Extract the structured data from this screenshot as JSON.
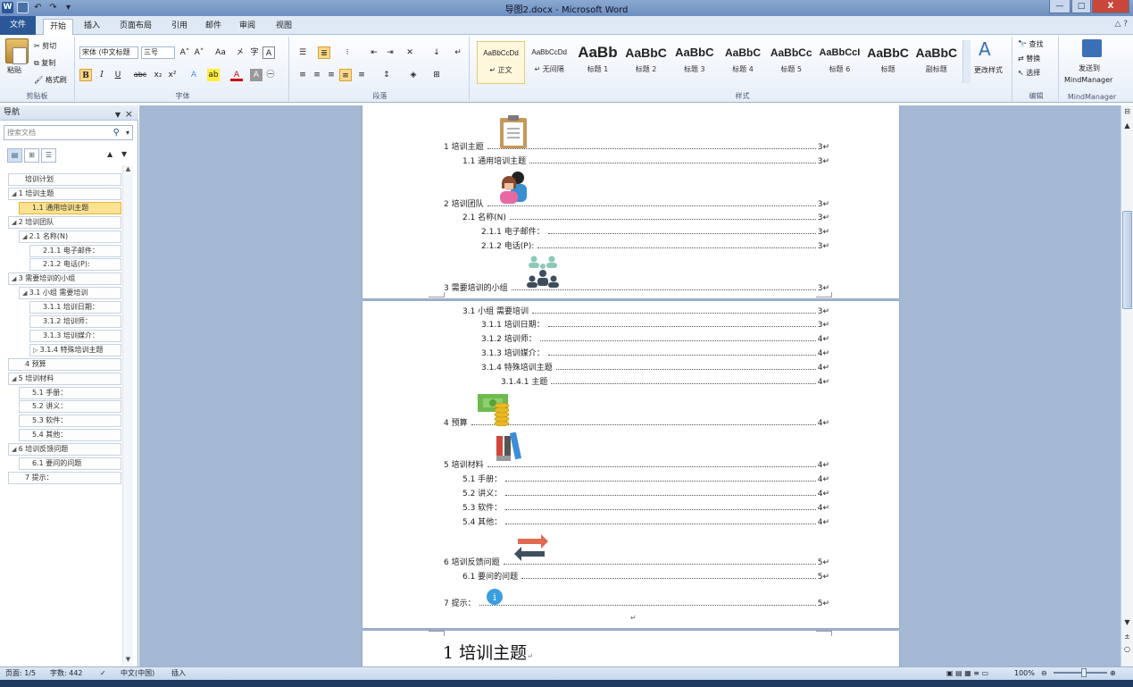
{
  "window": {
    "title": "导图2.docx - Microsoft Word",
    "close_label": "X",
    "min_label": "—",
    "max_label": "□"
  },
  "tabs": {
    "file": "文件",
    "items": [
      "开始",
      "插入",
      "页面布局",
      "引用",
      "邮件",
      "审阅",
      "视图"
    ]
  },
  "ribbon": {
    "clipboard": {
      "paste": "粘贴",
      "cut": "剪切",
      "copy": "复制",
      "format_painter": "格式刷",
      "label": "剪贴板"
    },
    "font": {
      "name": "宋体 (中文标题",
      "size": "三号",
      "label": "字体",
      "grow": "A˄",
      "shrink": "A˅",
      "case": "Aa",
      "clear": "A",
      "bold": "B",
      "italic": "I",
      "underline": "U",
      "strike": "abc",
      "sub": "x₂",
      "sup": "x²"
    },
    "paragraph": {
      "label": "段落"
    },
    "styles": {
      "label": "样式",
      "change_styles": "更改样式",
      "items": [
        {
          "sample": "AaBbCcDd",
          "name": "↵ 正文"
        },
        {
          "sample": "AaBbCcDd",
          "name": "↵ 无间隔"
        },
        {
          "sample": "AaBb",
          "name": "标题 1"
        },
        {
          "sample": "AaBbC",
          "name": "标题 2"
        },
        {
          "sample": "AaBbC",
          "name": "标题 3"
        },
        {
          "sample": "AaBbC",
          "name": "标题 4"
        },
        {
          "sample": "AaBbCc",
          "name": "标题 5"
        },
        {
          "sample": "AaBbCcI",
          "name": "标题 6"
        },
        {
          "sample": "AaBbC",
          "name": "标题"
        },
        {
          "sample": "AaBbC",
          "name": "副标题"
        }
      ]
    },
    "editing": {
      "find": "查找",
      "replace": "替换",
      "select": "选择",
      "label": "编辑"
    },
    "mindmanager": {
      "send": "发送到",
      "app": "MindManager",
      "label": "MindManager"
    }
  },
  "nav": {
    "title": "导航",
    "search_placeholder": "搜索文档",
    "items": [
      {
        "text": "培训计划",
        "lv": 0,
        "arrow": ""
      },
      {
        "text": "1 培训主题",
        "lv": 0,
        "arrow": "◢"
      },
      {
        "text": "1.1 通用培训主题",
        "lv": 1,
        "arrow": "",
        "selected": true
      },
      {
        "text": "2 培训团队",
        "lv": 0,
        "arrow": "◢"
      },
      {
        "text": "2.1 名称(N)",
        "lv": 1,
        "arrow": "◢"
      },
      {
        "text": "2.1.1 电子邮件：",
        "lv": 2,
        "arrow": ""
      },
      {
        "text": "2.1.2 电话(P):",
        "lv": 2,
        "arrow": ""
      },
      {
        "text": "3 需要培训的小组",
        "lv": 0,
        "arrow": "◢"
      },
      {
        "text": "3.1 小组 需要培训",
        "lv": 1,
        "arrow": "◢"
      },
      {
        "text": "3.1.1 培训日期：",
        "lv": 2,
        "arrow": ""
      },
      {
        "text": "3.1.2 培训师：",
        "lv": 2,
        "arrow": ""
      },
      {
        "text": "3.1.3 培训媒介：",
        "lv": 2,
        "arrow": ""
      },
      {
        "text": "3.1.4 特殊培训主题",
        "lv": 2,
        "arrow": "▷"
      },
      {
        "text": "4 预算",
        "lv": 0,
        "arrow": ""
      },
      {
        "text": "5 培训材料",
        "lv": 0,
        "arrow": "◢"
      },
      {
        "text": "5.1 手册：",
        "lv": 1,
        "arrow": ""
      },
      {
        "text": "5.2 讲义：",
        "lv": 1,
        "arrow": ""
      },
      {
        "text": "5.3 软件：",
        "lv": 1,
        "arrow": ""
      },
      {
        "text": "5.4 其他：",
        "lv": 1,
        "arrow": ""
      },
      {
        "text": "6 培训反馈问题",
        "lv": 0,
        "arrow": "◢"
      },
      {
        "text": "6.1 要问的问题",
        "lv": 1,
        "arrow": ""
      },
      {
        "text": "7 提示：",
        "lv": 0,
        "arrow": ""
      }
    ]
  },
  "doc": {
    "page1": [
      {
        "label": "1 培训主题",
        "page": "3↵",
        "lv": 0
      },
      {
        "label": "1.1  通用培训主题",
        "page": "3↵",
        "lv": 1
      },
      {
        "label": "2 培训团队",
        "page": "3↵",
        "lv": 0
      },
      {
        "label": "2.1  名称(N)",
        "page": "3↵",
        "lv": 1
      },
      {
        "label": "2.1.1  电子邮件：",
        "page": "3↵",
        "lv": 2
      },
      {
        "label": "2.1.2  电话(P):",
        "page": "3↵",
        "lv": 2
      },
      {
        "label": "3 需要培训的小组",
        "page": "3↵",
        "lv": 0
      }
    ],
    "page2": [
      {
        "label": "3.1  小组  需要培训",
        "page": "3↵",
        "lv": 1
      },
      {
        "label": "3.1.1  培训日期：",
        "page": "3↵",
        "lv": 2
      },
      {
        "label": "3.1.2  培训师：",
        "page": "4↵",
        "lv": 2
      },
      {
        "label": "3.1.3  培训媒介：",
        "page": "4↵",
        "lv": 2
      },
      {
        "label": "3.1.4  特殊培训主题",
        "page": "4↵",
        "lv": 2
      },
      {
        "label": "3.1.4.1  主题",
        "page": "4↵",
        "lv": 3
      },
      {
        "label": "4 预算",
        "page": "4↵",
        "lv": 0
      },
      {
        "label": "5 培训材料",
        "page": "4↵",
        "lv": 0
      },
      {
        "label": "5.1  手册：",
        "page": "4↵",
        "lv": 1
      },
      {
        "label": "5.2  讲义：",
        "page": "4↵",
        "lv": 1
      },
      {
        "label": "5.3  软件：",
        "page": "4↵",
        "lv": 1
      },
      {
        "label": "5.4  其他：",
        "page": "4↵",
        "lv": 1
      },
      {
        "label": "6 培训反馈问题",
        "page": "5↵",
        "lv": 0
      },
      {
        "label": "6.1  要问的问题",
        "page": "5↵",
        "lv": 1
      },
      {
        "label": "7 提示：",
        "page": "5↵",
        "lv": 0
      }
    ],
    "page2_end": "↵",
    "heading": "1 培训主题",
    "heading_mark": "↵"
  },
  "status": {
    "page": "页面: 1/5",
    "words": "字数: 442",
    "lang": "中文(中国)",
    "mode": "插入",
    "zoom": "100%"
  },
  "colors": {
    "accent": "#2b5797",
    "selected": "#fde391"
  }
}
